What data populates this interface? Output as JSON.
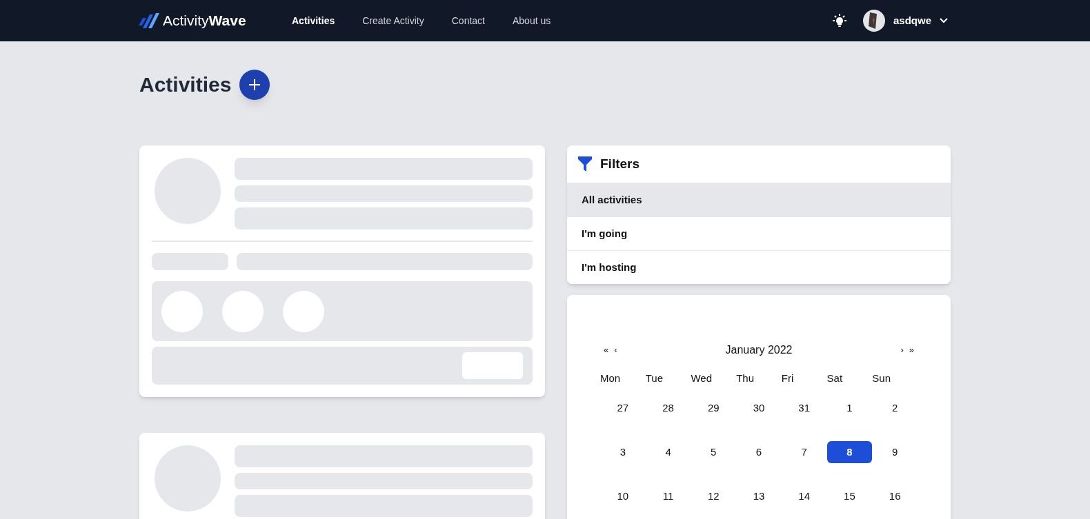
{
  "navbar": {
    "brand": {
      "first": "Activity",
      "second": "Wave"
    },
    "links": [
      {
        "label": "Activities",
        "selected": true
      },
      {
        "label": "Create Activity",
        "selected": false
      },
      {
        "label": "Contact",
        "selected": false
      },
      {
        "label": "About us",
        "selected": false
      }
    ],
    "user": {
      "name": "asdqwe"
    }
  },
  "page": {
    "title": "Activities"
  },
  "skeleton_cards": [
    {
      "kind": "placeholder"
    },
    {
      "kind": "partial"
    }
  ],
  "filters": {
    "title": "Filters",
    "items": [
      {
        "label": "All activities",
        "selected": true
      },
      {
        "label": "I'm going",
        "selected": false
      },
      {
        "label": "I'm hosting",
        "selected": false
      }
    ]
  },
  "calendar": {
    "nav_left": [
      "«",
      "‹"
    ],
    "month": "January 2022",
    "nav_right": [
      "›",
      "»"
    ],
    "weekdays": [
      "Mon",
      "Tue",
      "Wed",
      "Thu",
      "Fri",
      "Sat",
      "Sun"
    ],
    "weeks": [
      [
        {
          "day": "27",
          "selected": false
        },
        {
          "day": "28",
          "selected": false
        },
        {
          "day": "29",
          "selected": false
        },
        {
          "day": "30",
          "selected": false
        },
        {
          "day": "31",
          "selected": false
        },
        {
          "day": "1",
          "selected": false
        },
        {
          "day": "2",
          "selected": false
        }
      ],
      [
        {
          "day": "3",
          "selected": false
        },
        {
          "day": "4",
          "selected": false
        },
        {
          "day": "5",
          "selected": false
        },
        {
          "day": "6",
          "selected": false
        },
        {
          "day": "7",
          "selected": false
        },
        {
          "day": "8",
          "selected": true
        },
        {
          "day": "9",
          "selected": false
        }
      ],
      [
        {
          "day": "10",
          "selected": false
        },
        {
          "day": "11",
          "selected": false
        },
        {
          "day": "12",
          "selected": false
        },
        {
          "day": "13",
          "selected": false
        },
        {
          "day": "14",
          "selected": false
        },
        {
          "day": "15",
          "selected": false
        },
        {
          "day": "16",
          "selected": false
        }
      ]
    ]
  }
}
